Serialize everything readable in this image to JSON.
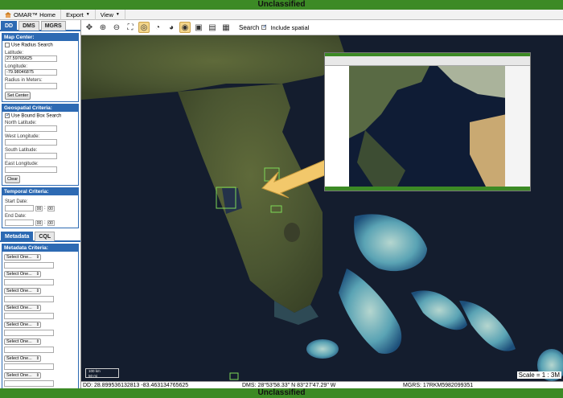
{
  "banner": {
    "top": "Unclassified",
    "bottom": "Unclassified"
  },
  "menu": {
    "home": "OMAR™ Home",
    "export": "Export",
    "view": "View"
  },
  "coord_tabs": [
    "DD",
    "DMS",
    "MGRS"
  ],
  "map_center": {
    "title": "Map Center:",
    "radius_search_label": "Use Radius Search",
    "lat_label": "Latitude:",
    "lat_value": "27.59765625",
    "lon_label": "Longitude:",
    "lon_value": "-79.98046875",
    "radius_label": "Radius in Meters:",
    "set_center": "Set Center"
  },
  "geospatial": {
    "title": "Geospatial Criteria:",
    "bbox_label": "Use Bound Box Search",
    "north": "North Latitude:",
    "west": "West Longitude:",
    "south": "South Latitude:",
    "east": "East Longitude:",
    "clear": "Clear"
  },
  "temporal": {
    "title": "Temporal Criteria:",
    "start": "Start Date:",
    "end": "End Date:",
    "start_h": "00",
    "start_m": "00",
    "end_h": "00",
    "end_m": "00"
  },
  "meta_tabs": [
    "Metadata",
    "CQL"
  ],
  "metadata": {
    "title": "Metadata Criteria:",
    "select_label": "Select One..."
  },
  "toolbar": {
    "search_label": "Search",
    "include_spatial": "Include spatial"
  },
  "status": {
    "dd": "DD: 28.899536132813 -83.463134765625",
    "dms": "DMS: 28°53'58.33\" N 83°27'47.29\" W",
    "mgrs": "MGRS: 17RKM5982099351"
  },
  "scale": {
    "label": "Scale = 1 : 3M",
    "km": "100 km",
    "mi": "50 mi"
  }
}
